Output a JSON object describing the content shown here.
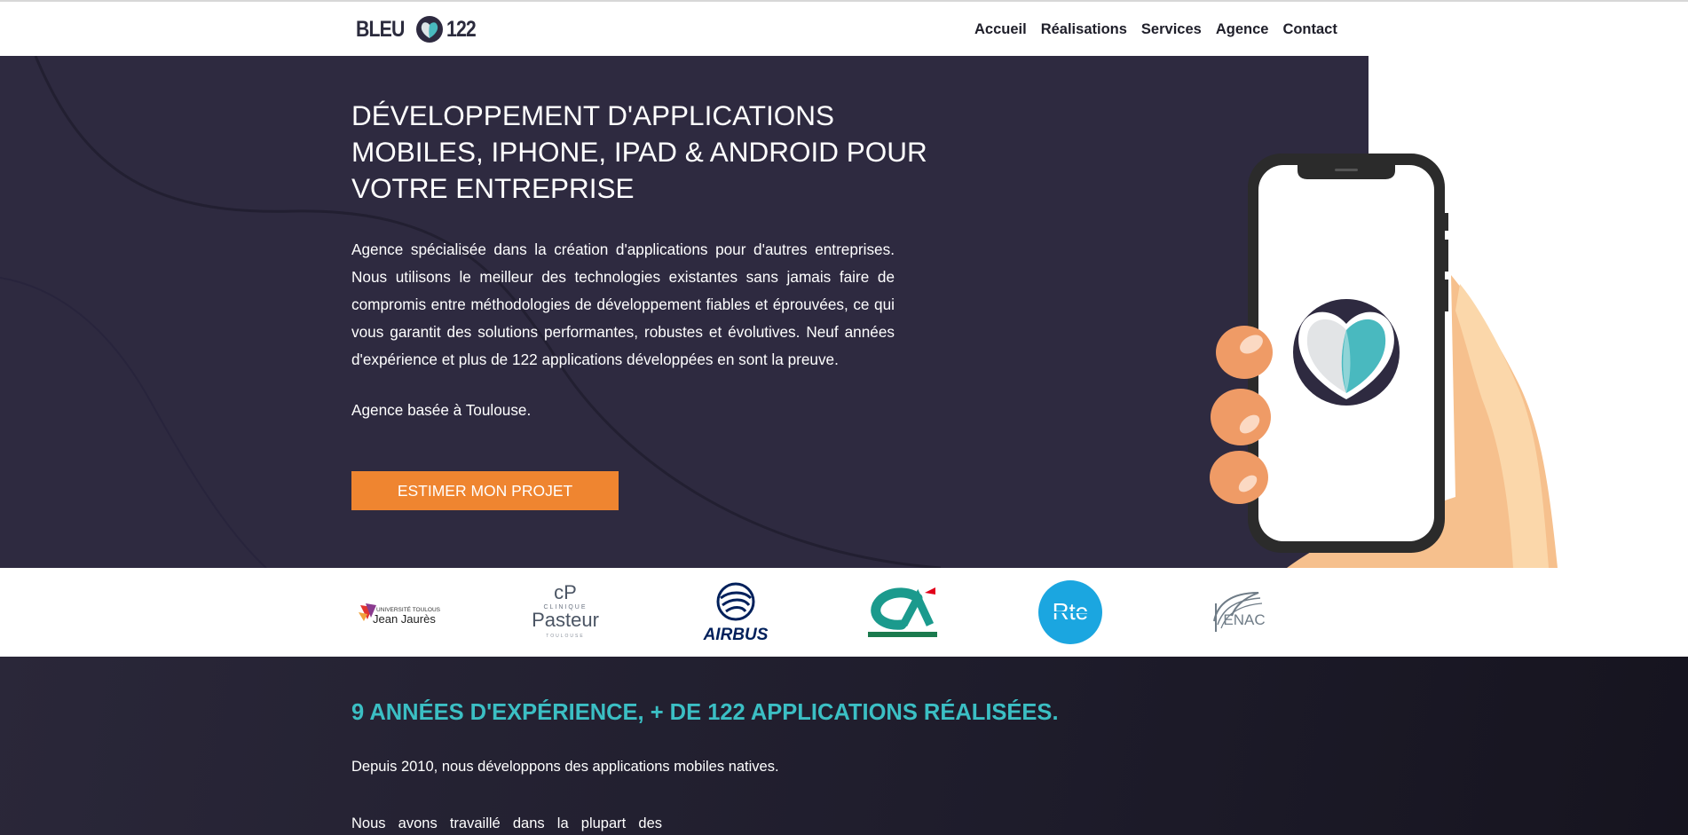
{
  "header": {
    "logo_left": "BLEU",
    "logo_right": "122",
    "nav": [
      "Accueil",
      "Réalisations",
      "Services",
      "Agence",
      "Contact"
    ]
  },
  "hero": {
    "title": "DÉVELOPPEMENT D'APPLICATIONS MOBILES, IPHONE, IPAD & ANDROID POUR VOTRE ENTREPRISE",
    "text": "Agence spécialisée dans la création d'applications pour d'autres entreprises. Nous utilisons le meilleur des technologies existantes sans jamais faire de compromis entre méthodologies de développement fiables et éprouvées, ce qui vous garantit des solutions performantes, robustes et évolutives. Neuf années d'expérience et plus de 122 applications développées en sont la preuve.",
    "location": "Agence basée à Toulouse.",
    "cta": "ESTIMER MON PROJET"
  },
  "clients": {
    "ut2j_small": "UNIVERSITÉ TOULOUSE",
    "ut2j_name": "Jean Jaurès",
    "pasteur_mark": "cP",
    "pasteur_top": "CLINIQUE",
    "pasteur_name": "Pasteur",
    "pasteur_city": "TOULOUSE",
    "airbus": "AIRBUS",
    "rte": "Rte",
    "enac": "ENAC"
  },
  "section2": {
    "title": "9 ANNÉES D'EXPÉRIENCE, + DE 122 APPLICATIONS RÉALISÉES.",
    "p1": "Depuis 2010, nous développons des applications mobiles natives.",
    "p2": "Nous avons travaillé dans la plupart des"
  },
  "colors": {
    "hero_bg": "#2e2a40",
    "cta": "#ef8530",
    "accent": "#3bbfc4"
  }
}
